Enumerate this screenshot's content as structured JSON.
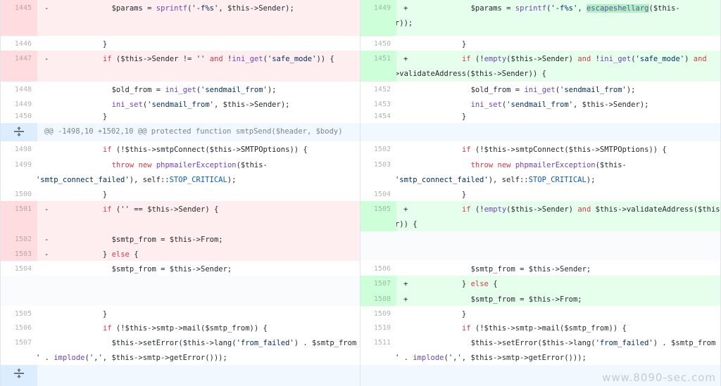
{
  "rows": [
    {
      "left": {
        "num": "1445",
        "mark": "-",
        "lines": [
          "        $params = sprintf('-f%s', $this->Sender);"
        ]
      },
      "right": {
        "num": "1449",
        "mark": "+",
        "lines": [
          "        $params = sprintf('-f%s', escapeshellarg($this-",
          ">Sender));"
        ]
      }
    },
    {
      "left": {
        "num": "1446",
        "lines": [
          "      }"
        ]
      },
      "right": {
        "num": "1450",
        "lines": [
          "      }"
        ]
      }
    },
    {
      "left": {
        "num": "1447",
        "mark": "-",
        "lines": [
          "      if ($this->Sender != '' and !ini_get('safe_mode')) {"
        ]
      },
      "right": {
        "num": "1451",
        "mark": "+",
        "lines": [
          "      if (!empty($this->Sender) and !ini_get('safe_mode') and",
          "$this->validateAddress($this->Sender)) {"
        ]
      }
    },
    {
      "left": {
        "num": "1448",
        "lines": [
          "        $old_from = ini_get('sendmail_from');"
        ]
      },
      "right": {
        "num": "1452",
        "lines": [
          "        $old_from = ini_get('sendmail_from');"
        ]
      }
    },
    {
      "left": {
        "num": "1449",
        "lines": [
          "        ini_set('sendmail_from', $this->Sender);"
        ]
      },
      "right": {
        "num": "1453",
        "lines": [
          "        ini_set('sendmail_from', $this->Sender);"
        ]
      }
    },
    {
      "left": {
        "num": "1450",
        "lines": [
          "      }"
        ]
      },
      "right": {
        "num": "1454",
        "lines": [
          "      }"
        ]
      }
    },
    {
      "hunk": "@@ -1498,10 +1502,10 @@ protected function smtpSend($header, $body)"
    },
    {
      "left": {
        "num": "1498",
        "lines": [
          "      if (!$this->smtpConnect($this->SMTPOptions)) {"
        ]
      },
      "right": {
        "num": "1502",
        "lines": [
          "      if (!$this->smtpConnect($this->SMTPOptions)) {"
        ]
      }
    },
    {
      "left": {
        "num": "1499",
        "lines": [
          "        throw new phpmailerException($this-",
          ">lang('smtp_connect_failed'), self::STOP_CRITICAL);"
        ]
      },
      "right": {
        "num": "1503",
        "lines": [
          "        throw new phpmailerException($this-",
          ">lang('smtp_connect_failed'), self::STOP_CRITICAL);"
        ]
      }
    },
    {
      "left": {
        "num": "1500",
        "lines": [
          "      }"
        ]
      },
      "right": {
        "num": "1504",
        "lines": [
          "      }"
        ]
      }
    },
    {
      "left": {
        "num": "1501",
        "mark": "-",
        "lines": [
          "      if ('' == $this->Sender) {"
        ]
      },
      "right": {
        "num": "1505",
        "mark": "+",
        "lines": [
          "      if (!empty($this->Sender) and $this->validateAddress($this-",
          ">Sender)) {"
        ]
      }
    },
    {
      "left": {
        "num": "1502",
        "mark": "-",
        "lines": [
          "        $smtp_from = $this->From;"
        ]
      },
      "right": null
    },
    {
      "left": {
        "num": "1503",
        "mark": "-",
        "lines": [
          "      } else {"
        ]
      },
      "right": null
    },
    {
      "left": {
        "num": "1504",
        "lines": [
          "        $smtp_from = $this->Sender;"
        ]
      },
      "right": {
        "num": "1506",
        "lines": [
          "        $smtp_from = $this->Sender;"
        ]
      }
    },
    {
      "left": null,
      "right": {
        "num": "1507",
        "mark": "+",
        "lines": [
          "      } else {"
        ]
      }
    },
    {
      "left": null,
      "right": {
        "num": "1508",
        "mark": "+",
        "lines": [
          "        $smtp_from = $this->From;"
        ]
      }
    },
    {
      "left": {
        "num": "1505",
        "lines": [
          "      }"
        ]
      },
      "right": {
        "num": "1509",
        "lines": [
          "      }"
        ]
      }
    },
    {
      "left": {
        "num": "1506",
        "lines": [
          "      if (!$this->smtp->mail($smtp_from)) {"
        ]
      },
      "right": {
        "num": "1510",
        "lines": [
          "      if (!$this->smtp->mail($smtp_from)) {"
        ]
      }
    },
    {
      "left": {
        "num": "1507",
        "lines": [
          "        $this->setError($this->lang('from_failed') . $smtp_from",
          ". ' : ' . implode(',', $this->smtp->getError()));"
        ]
      },
      "right": {
        "num": "1511",
        "lines": [
          "        $this->setError($this->lang('from_failed') . $smtp_from",
          ". ' : ' . implode(',', $this->smtp->getError()));"
        ]
      }
    },
    {
      "hunk": ""
    }
  ],
  "highlights": {
    "left_0": "",
    "right_0": "escapeshellarg",
    "left_2": " != ''",
    "right_2": "!empty"
  },
  "watermark": "www.8090-sec.com"
}
